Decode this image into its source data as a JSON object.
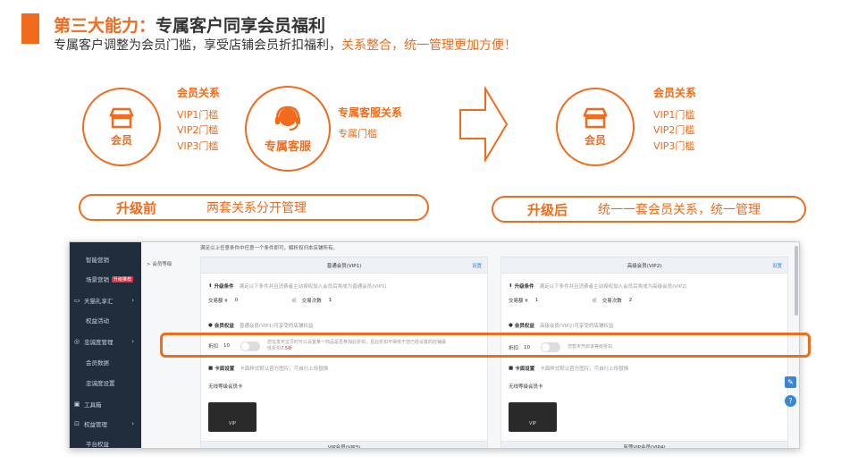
{
  "header": {
    "title_prefix": "第三大能力：",
    "title_main": "专属客户同享会员福利",
    "subtitle_plain": "专属客户调整为会员门槛，享受店铺会员折扣福利，",
    "subtitle_highlight": "关系整合，统一管理更加方便！"
  },
  "before": {
    "member_circle_label": "会员",
    "member_relation_title": "会员关系",
    "member_relations": [
      "VIP1门槛",
      "VIP2门槛",
      "VIP3门槛"
    ],
    "service_circle_label": "专属客服",
    "service_relation_title": "专属客服关系",
    "service_relation_item": "专属门槛"
  },
  "after": {
    "member_circle_label": "会员",
    "member_relation_title": "会员关系",
    "member_relations": [
      "VIP1门槛",
      "VIP2门槛",
      "VIP3门槛"
    ]
  },
  "pills": {
    "before_label": "升级前",
    "before_text": "两套关系分开管理",
    "after_label": "升级后",
    "after_text": "统一一套会员关系，统一管理"
  },
  "app": {
    "notice": "满足以上任意条件中任意一个条件即可，解析权归本店铺所有。",
    "breadcrumb": "> 会员等级",
    "sidebar": [
      {
        "label": "智能营销",
        "type": "sub"
      },
      {
        "label": "场景营销",
        "type": "sub",
        "badge": "升级推荐"
      },
      {
        "label": "天猫礼享汇",
        "type": "main",
        "icon": "gift-icon"
      },
      {
        "label": "权益活动",
        "type": "sub"
      },
      {
        "label": "忠诚度管理",
        "type": "main",
        "icon": "target-icon"
      },
      {
        "label": "会员数据",
        "type": "sub"
      },
      {
        "label": "忠诚度设置",
        "type": "sub"
      },
      {
        "label": "工具箱",
        "type": "main",
        "icon": "toolbox-icon"
      },
      {
        "label": "权益管理",
        "type": "main",
        "icon": "cart-icon"
      },
      {
        "label": "平台权益",
        "type": "sub"
      }
    ],
    "cards": [
      {
        "title": "普通会员(VIP1)",
        "settings": "设置",
        "upgrade_label": "升级条件",
        "upgrade_desc": "满足以下条件并且消费者主动授权加入会员后将成为普通会员(VIP1)",
        "trade_amount_label": "交易额 ¥",
        "trade_amount_value": "0",
        "or_label": "或",
        "trade_count_label": "交易次数",
        "trade_count_value": "1",
        "benefit_label": "会员权益",
        "benefit_desc": "普通会员(VIP1)可享受的店铺权益",
        "discount_label": "折扣",
        "discount_value": "10",
        "discount_note": "您在发布宝贝时可以设置某一商品是否参加此折扣，且此折扣不得低于您已经设置的店铺最低折扣",
        "discount_note_red": "7.5折",
        "card_settings_label": "卡面设置",
        "card_settings_desc": "卡面样式默认官方图片，可自行上传替换",
        "card_name": "无线等级会员卡",
        "vip_text": "VIP"
      },
      {
        "title": "高级会员(VIP2)",
        "settings": "设置",
        "upgrade_label": "升级条件",
        "upgrade_desc": "满足以下条件并且消费者主动授权加入会员后将成为高级会员(VIP2)",
        "trade_amount_label": "交易额 ¥",
        "trade_amount_value": "1",
        "or_label": "或",
        "trade_count_label": "交易次数",
        "trade_count_value": "2",
        "benefit_label": "会员权益",
        "benefit_desc": "高级会员(VIP2)可享受的店铺权益",
        "discount_label": "折扣",
        "discount_value": "10",
        "discount_note": "您暂未开启该等级折扣",
        "discount_note_red": "",
        "card_settings_label": "卡面设置",
        "card_settings_desc": "卡面样式默认官方图片，可自行上传替换",
        "card_name": "无线等级会员卡",
        "vip_text": "VIP"
      }
    ],
    "bottom_headers": [
      "VIP会员(VIP3)",
      "至尊VIP会员(VIP4)"
    ],
    "fab_edit": "✎",
    "fab_help": "?"
  },
  "colors": {
    "accent": "#f26b1d",
    "sidebar": "#1f2d3d",
    "link": "#3a85d8"
  }
}
